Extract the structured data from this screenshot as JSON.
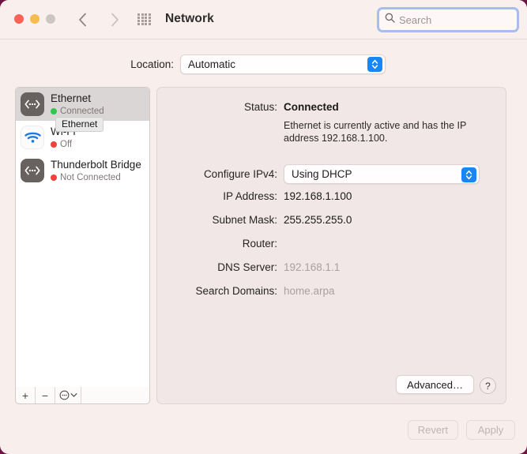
{
  "window": {
    "title": "Network",
    "background_color": "#f8eeec",
    "desktop_color": "#6e1442"
  },
  "toolbar": {
    "traffic_lights": [
      {
        "name": "close",
        "color": "#fa6157"
      },
      {
        "name": "minimize",
        "color": "#f5bd4f"
      },
      {
        "name": "maximize",
        "color": "#ccc5c4"
      }
    ],
    "back_icon": "chevron-left-icon",
    "forward_icon": "chevron-right-icon",
    "grid_icon": "grid-dots-icon",
    "title": "Network",
    "search": {
      "icon": "search-icon",
      "placeholder": "Search",
      "value": "",
      "focused": true,
      "focus_ring_color": "#a7bdf0"
    }
  },
  "location": {
    "label": "Location:",
    "value": "Automatic",
    "options": [
      "Automatic"
    ],
    "stepper_color": "#1886f5"
  },
  "sidebar": {
    "services": [
      {
        "name": "Ethernet",
        "status": "Connected",
        "status_color": "#2ec84b",
        "icon": "ethernet-icon",
        "icon_style": "dark",
        "selected": true
      },
      {
        "name": "Wi-Fi",
        "status": "Off",
        "status_color": "#f0413a",
        "icon": "wifi-icon",
        "icon_style": "light",
        "selected": false
      },
      {
        "name": "Thunderbolt Bridge",
        "status": "Not Connected",
        "status_color": "#f0413a",
        "icon": "ethernet-icon",
        "icon_style": "dark",
        "selected": false
      }
    ],
    "tooltip": "Ethernet",
    "footer": {
      "add_label": "+",
      "remove_label": "−",
      "options_icon": "ellipsis-circle-icon",
      "options_chevron_icon": "chevron-down-icon"
    }
  },
  "detail": {
    "status": {
      "label": "Status:",
      "value": "Connected",
      "description": "Ethernet is currently active and has the IP address 192.168.1.100."
    },
    "configure_ipv4": {
      "label": "Configure IPv4:",
      "value": "Using DHCP",
      "options": [
        "Using DHCP"
      ]
    },
    "fields": [
      {
        "label": "IP Address:",
        "value": "192.168.1.100",
        "muted": false
      },
      {
        "label": "Subnet Mask:",
        "value": "255.255.255.0",
        "muted": false
      },
      {
        "label": "Router:",
        "value": "",
        "muted": false
      },
      {
        "label": "DNS Server:",
        "value": "192.168.1.1",
        "muted": true
      },
      {
        "label": "Search Domains:",
        "value": "home.arpa",
        "muted": true
      }
    ],
    "advanced_label": "Advanced…",
    "help_label": "?"
  },
  "bottom": {
    "revert_label": "Revert",
    "apply_label": "Apply",
    "disabled": true
  }
}
